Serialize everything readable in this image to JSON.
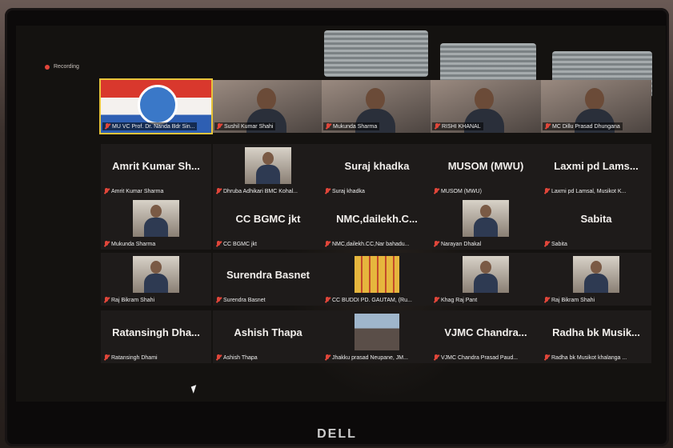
{
  "recording": {
    "label": "Recording"
  },
  "brand": {
    "logo_text": "DELL"
  },
  "colors": {
    "active_speaker": "#e8c43a",
    "muted_icon": "#e0463a",
    "tile_bg": "#1e1b1a"
  },
  "tiles": [
    {
      "type": "flag",
      "active": true,
      "label": "MU VC Prof. Dr. Nanda Bdr Sin..."
    },
    {
      "type": "video",
      "label": "Sushil Kumar Shahi"
    },
    {
      "type": "video",
      "label": "Mukunda Sharma"
    },
    {
      "type": "video",
      "label": "RISHI KHANAL"
    },
    {
      "type": "video",
      "label": "MC Dillu Prasad Dhungana"
    },
    {
      "type": "name",
      "big": "Amrit Kumar Sh...",
      "label": "Amrit Kumar Sharma"
    },
    {
      "type": "photo",
      "label": "Dhruba Adhikari BMC Kohal..."
    },
    {
      "type": "name",
      "big": "Suraj khadka",
      "label": "Suraj khadka"
    },
    {
      "type": "name",
      "big": "MUSOM (MWU)",
      "label": "MUSOM (MWU)"
    },
    {
      "type": "name",
      "big": "Laxmi pd Lams...",
      "label": "Laxmi pd Lamsal, Musikot K..."
    },
    {
      "type": "photo",
      "label": "Mukunda Sharma"
    },
    {
      "type": "name",
      "big": "CC BGMC jkt",
      "label": "CC BGMC jkt"
    },
    {
      "type": "name",
      "big": "NMC,dailekh.C...",
      "label": "NMC,dailekh.CC,Nar bahadu..."
    },
    {
      "type": "photo",
      "label": "Narayan Dhakal"
    },
    {
      "type": "name",
      "big": "Sabita",
      "label": "Sabita"
    },
    {
      "type": "photo",
      "label": "Raj Bikram Shahi"
    },
    {
      "type": "name",
      "big": "Surendra Basnet",
      "label": "Surendra Basnet"
    },
    {
      "type": "building",
      "label": "CC BUDDI PD. GAUTAM, (Ru..."
    },
    {
      "type": "photo",
      "label": "Khag Raj Pant"
    },
    {
      "type": "photo",
      "label": "Raj Bikram Shahi"
    },
    {
      "type": "name",
      "big": "Ratansingh Dha...",
      "label": "Ratansingh Dhami"
    },
    {
      "type": "name",
      "big": "Ashish Thapa",
      "label": "Ashish Thapa"
    },
    {
      "type": "group",
      "label": "Jhakku prasad Neupane, JM..."
    },
    {
      "type": "name",
      "big": "VJMC Chandra...",
      "label": "VJMC Chandra Prasad Paud..."
    },
    {
      "type": "name",
      "big": "Radha bk Musik...",
      "label": "Radha bk Musikot khalanga ..."
    }
  ]
}
